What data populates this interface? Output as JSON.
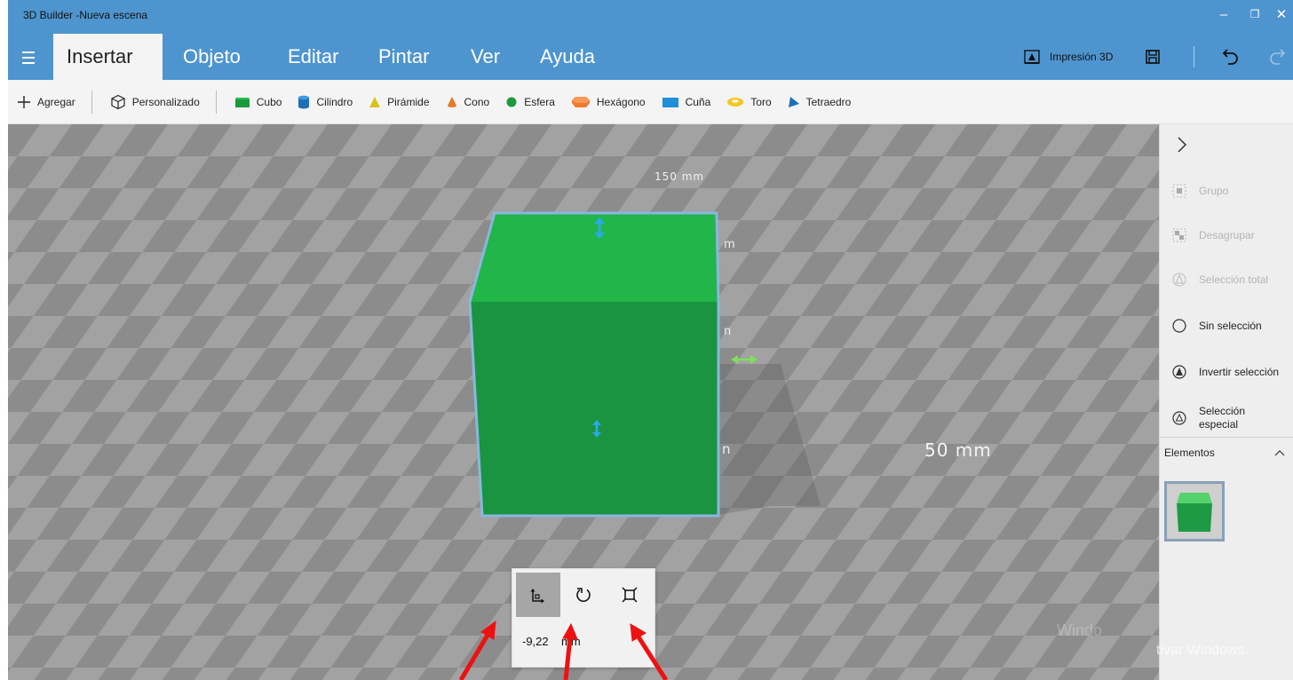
{
  "window": {
    "title": "3D Builder -Nueva escena",
    "controls": {
      "minimize": "–",
      "restore": "❐",
      "close": "✕"
    }
  },
  "menu": {
    "tabs": [
      {
        "label": "Insertar",
        "active": true
      },
      {
        "label": "Objeto"
      },
      {
        "label": "Editar"
      },
      {
        "label": "Pintar"
      },
      {
        "label": "Ver"
      },
      {
        "label": "Ayuda"
      }
    ],
    "print_label": "Impresión 3D"
  },
  "toolbar": {
    "add": "Agregar",
    "custom": "Personalizado",
    "shapes": [
      {
        "label": "Cubo",
        "color": "#1a9a3f"
      },
      {
        "label": "Cilindro",
        "color": "#1f6fb7"
      },
      {
        "label": "Pirámide",
        "color": "#d9c21a"
      },
      {
        "label": "Cono",
        "color": "#e07b2a"
      },
      {
        "label": "Esfera",
        "color": "#1a9a3f"
      },
      {
        "label": "Hexágono",
        "color": "#f07b2e"
      },
      {
        "label": "Cuña",
        "color": "#1f8fd8"
      },
      {
        "label": "Toro",
        "color": "#f2c81d"
      },
      {
        "label": "Tetraedro",
        "color": "#1f6fb7"
      }
    ]
  },
  "viewport": {
    "label_150": "150 mm",
    "label_50": "50 mm",
    "partial_m1": "m",
    "partial_n1": "n",
    "partial_n2": "n",
    "cube_color": "#1fa844"
  },
  "gizmo": {
    "value": "-9,22",
    "unit": "mm",
    "modes": [
      "move",
      "rotate",
      "scale"
    ]
  },
  "sidepanel": {
    "items": [
      {
        "label": "Grupo",
        "enabled": false
      },
      {
        "label": "Desagrupar",
        "enabled": false
      },
      {
        "label": "Selección total",
        "enabled": false
      },
      {
        "label": "Sin selección",
        "enabled": true
      },
      {
        "label": "Invertir selección",
        "enabled": true
      },
      {
        "label": "Selección especial",
        "enabled": true
      }
    ],
    "elements_label": "Elementos"
  },
  "watermark": "tivar Windows.",
  "watermark_ghost": "Windo"
}
